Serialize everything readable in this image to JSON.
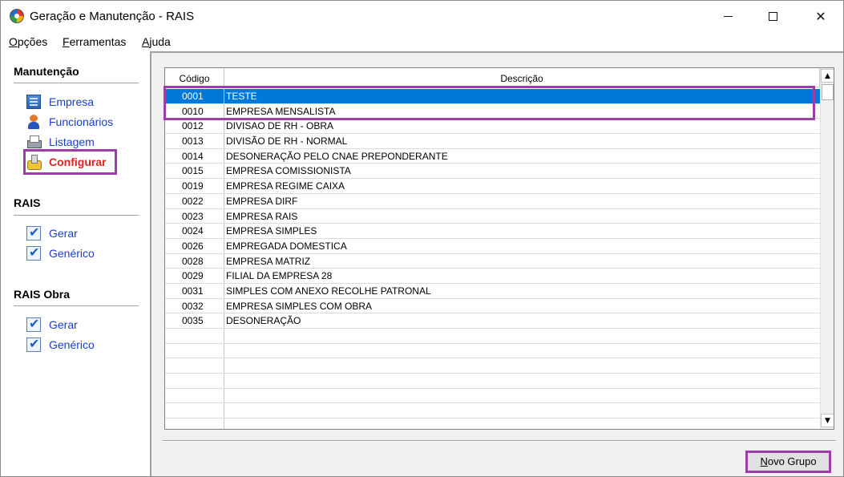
{
  "window": {
    "title": "Geração e Manutenção - RAIS",
    "minimize_icon": "minimize-icon",
    "maximize_icon": "maximize-icon",
    "close_icon": "close-icon"
  },
  "menu": [
    {
      "mnemonic": "O",
      "rest": "pções"
    },
    {
      "mnemonic": "F",
      "rest": "erramentas"
    },
    {
      "mnemonic": "A",
      "rest": "juda"
    }
  ],
  "sidebar": {
    "sections": [
      {
        "title": "Manutenção",
        "items": [
          {
            "label": "Empresa",
            "icon": "building-icon"
          },
          {
            "label": "Funcionários",
            "icon": "person-icon"
          },
          {
            "label": "Listagem",
            "icon": "printer-icon"
          },
          {
            "label": "Configurar",
            "icon": "configure-icon",
            "active": true
          }
        ]
      },
      {
        "title": "RAIS",
        "items": [
          {
            "label": "Gerar",
            "icon": "checkbox-icon"
          },
          {
            "label": "Genérico",
            "icon": "checkbox-icon"
          }
        ]
      },
      {
        "title": "RAIS Obra",
        "items": [
          {
            "label": "Gerar",
            "icon": "checkbox-icon"
          },
          {
            "label": "Genérico",
            "icon": "checkbox-icon"
          }
        ]
      }
    ]
  },
  "grid": {
    "columns": [
      "Código",
      "Descrição"
    ],
    "rows": [
      {
        "codigo": "0001",
        "descricao": "TESTE",
        "selected": true
      },
      {
        "codigo": "0010",
        "descricao": "EMPRESA MENSALISTA"
      },
      {
        "codigo": "0012",
        "descricao": "DIVISAO DE RH - OBRA"
      },
      {
        "codigo": "0013",
        "descricao": "DIVISÃO DE RH - NORMAL"
      },
      {
        "codigo": "0014",
        "descricao": "DESONERAÇÃO PELO CNAE PREPONDERANTE"
      },
      {
        "codigo": "0015",
        "descricao": "EMPRESA COMISSIONISTA"
      },
      {
        "codigo": "0019",
        "descricao": "EMPRESA REGIME CAIXA"
      },
      {
        "codigo": "0022",
        "descricao": "EMPRESA DIRF"
      },
      {
        "codigo": "0023",
        "descricao": "EMPRESA RAIS"
      },
      {
        "codigo": "0024",
        "descricao": "EMPRESA SIMPLES"
      },
      {
        "codigo": "0026",
        "descricao": "EMPREGADA DOMESTICA"
      },
      {
        "codigo": "0028",
        "descricao": "EMPRESA MATRIZ"
      },
      {
        "codigo": "0029",
        "descricao": "FILIAL DA EMPRESA 28"
      },
      {
        "codigo": "0031",
        "descricao": "SIMPLES COM ANEXO RECOLHE PATRONAL"
      },
      {
        "codigo": "0032",
        "descricao": "EMPRESA SIMPLES COM OBRA"
      },
      {
        "codigo": "0035",
        "descricao": "DESONERAÇÃO"
      }
    ],
    "scroll_up_icon": "scroll-up-icon",
    "scroll_down_icon": "scroll-down-icon"
  },
  "footer": {
    "novo_grupo": {
      "mnemonic": "N",
      "rest": "ovo Grupo"
    }
  },
  "colors": {
    "selection": "#0078d7",
    "link": "#1a3fc7",
    "active_link": "#e02020",
    "highlight_box": "#9b3fa6"
  }
}
